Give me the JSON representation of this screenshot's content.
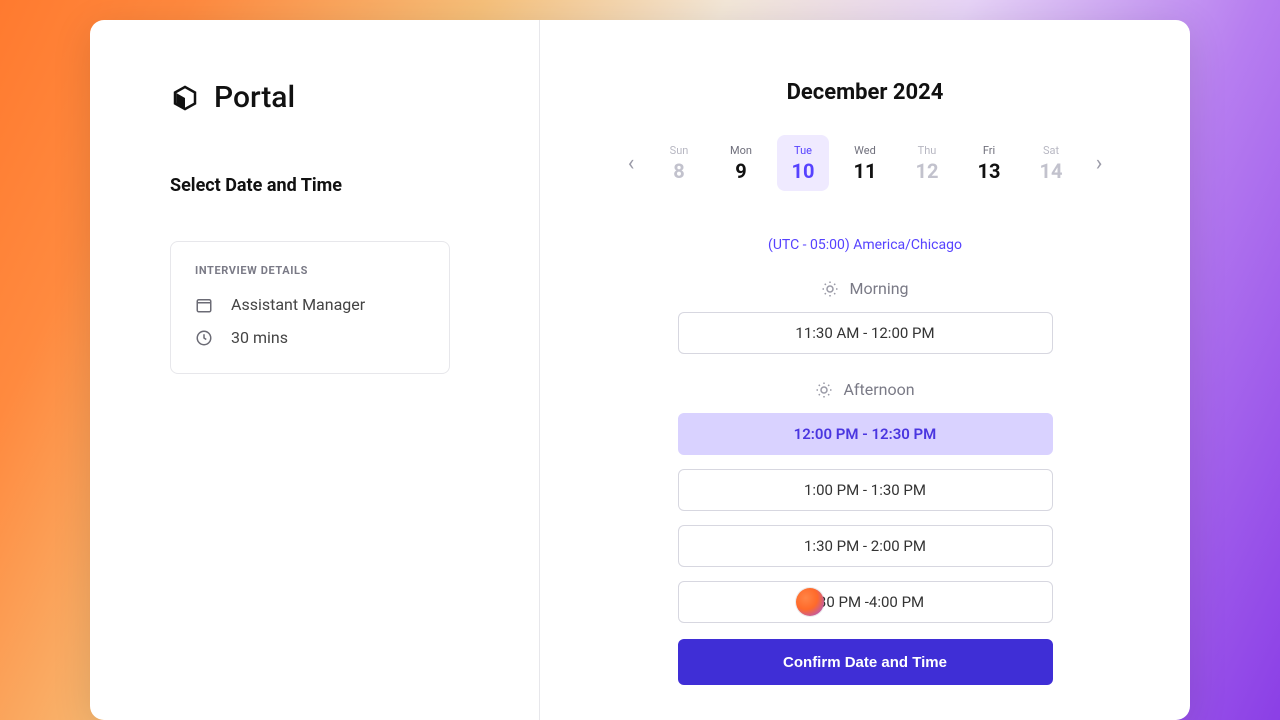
{
  "brand": {
    "name": "Portal"
  },
  "page_title": "Select Date and Time",
  "details": {
    "header": "INTERVIEW DETAILS",
    "position": "Assistant Manager",
    "duration": "30 mins"
  },
  "calendar": {
    "month_label": "December 2024",
    "days": [
      {
        "dow": "Sun",
        "num": "8",
        "available": false,
        "selected": false
      },
      {
        "dow": "Mon",
        "num": "9",
        "available": true,
        "selected": false
      },
      {
        "dow": "Tue",
        "num": "10",
        "available": true,
        "selected": true
      },
      {
        "dow": "Wed",
        "num": "11",
        "available": true,
        "selected": false
      },
      {
        "dow": "Thu",
        "num": "12",
        "available": false,
        "selected": false
      },
      {
        "dow": "Fri",
        "num": "13",
        "available": true,
        "selected": false
      },
      {
        "dow": "Sat",
        "num": "14",
        "available": false,
        "selected": false
      }
    ]
  },
  "timezone": "(UTC - 05:00) America/Chicago",
  "periods": {
    "morning": {
      "label": "Morning",
      "slots": [
        {
          "label": "11:30 AM  - 12:00 PM",
          "selected": false
        }
      ]
    },
    "afternoon": {
      "label": "Afternoon",
      "slots": [
        {
          "label": "12:00 PM - 12:30 PM",
          "selected": true
        },
        {
          "label": "1:00 PM - 1:30 PM",
          "selected": false
        },
        {
          "label": "1:30 PM - 2:00 PM",
          "selected": false
        },
        {
          "label": "3:30 PM -4:00 PM",
          "selected": false
        }
      ]
    }
  },
  "confirm_label": "Confirm Date and Time"
}
